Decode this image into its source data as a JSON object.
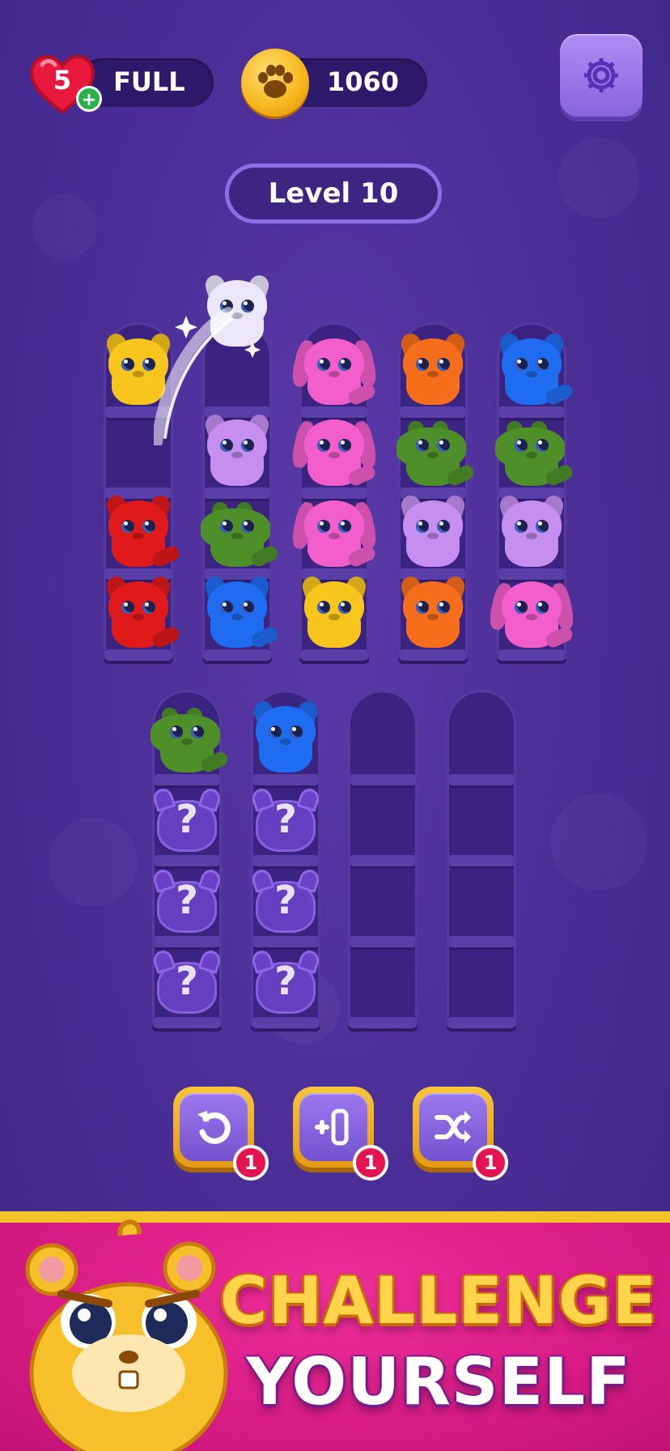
{
  "hud": {
    "lives": "5",
    "lives_status": "FULL",
    "coins": "1060"
  },
  "level": {
    "label": "Level 10"
  },
  "colors": {
    "yellow": "#f7c51c",
    "white": "#ece6fb",
    "pink": "#f25ecb",
    "orange": "#f66d1b",
    "blue": "#1f6cf0",
    "lilac": "#c58ef0",
    "green": "#4f8f2a",
    "red": "#e01a1a",
    "mystery": "#6b42c7"
  },
  "top_shelves": [
    [
      "yellow-puppy",
      "empty",
      "red-dragon",
      "red-dragon"
    ],
    [
      "white-puppy",
      "lilac-hamster",
      "green-gator",
      "blue-cat"
    ],
    [
      "pink-bunny",
      "pink-bunny",
      "pink-bunny",
      "yellow-puppy"
    ],
    [
      "orange-hamster",
      "green-gator",
      "lilac-hamster",
      "orange-hamster"
    ],
    [
      "blue-cat",
      "green-gator",
      "lilac-hamster",
      "pink-bunny"
    ]
  ],
  "bottom_shelves": [
    [
      "green-gator",
      "mystery",
      "mystery",
      "mystery"
    ],
    [
      "blue-puppy",
      "mystery",
      "mystery",
      "mystery"
    ],
    [
      "empty",
      "empty",
      "empty",
      "empty"
    ],
    [
      "empty",
      "empty",
      "empty",
      "empty"
    ]
  ],
  "mystery_symbol": "?",
  "boosters": [
    {
      "name": "undo",
      "icon": "undo-icon",
      "count": "1"
    },
    {
      "name": "add-shelf",
      "icon": "add-shelf-icon",
      "count": "1"
    },
    {
      "name": "shuffle",
      "icon": "shuffle-icon",
      "count": "1"
    }
  ],
  "banner": {
    "line1": "CHALLENGE",
    "line2": "YOURSELF"
  }
}
